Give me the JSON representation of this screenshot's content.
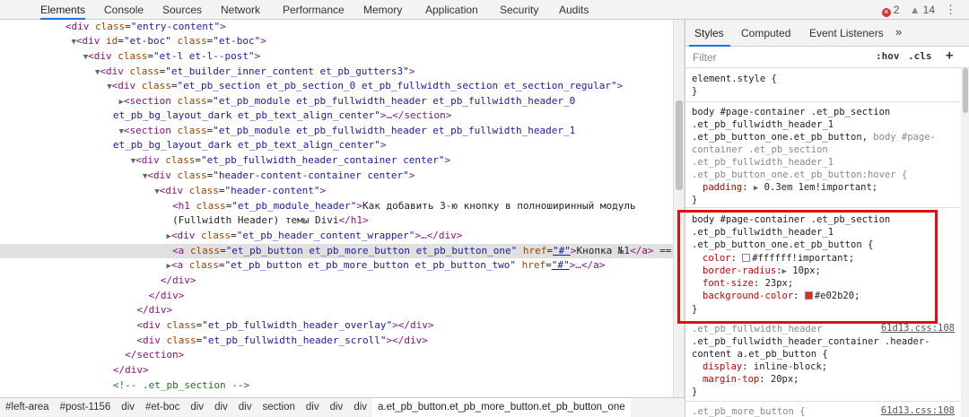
{
  "tabs": [
    {
      "label": "Elements",
      "active": true
    },
    {
      "label": "Console"
    },
    {
      "label": "Sources"
    },
    {
      "label": "Network"
    },
    {
      "label": "Performance"
    },
    {
      "label": "Memory"
    },
    {
      "label": "Application"
    },
    {
      "label": "Security"
    },
    {
      "label": "Audits"
    }
  ],
  "counts": {
    "errors": "2",
    "warnings": "14"
  },
  "icons": {
    "error": "error-icon",
    "warning": "warning-icon",
    "menu": "kebab-menu-icon",
    "more": "chevron-double-right-icon"
  },
  "dom": {
    "l0": {
      "tag": "<div ",
      "a1": "class",
      "v1": "\"entry-content\"",
      "end": ">"
    },
    "l1": {
      "tag": "<div ",
      "a1": "id",
      "v1": "\"et-boc\"",
      "a2": "class",
      "v2": "\"et-boc\"",
      "end": ">"
    },
    "l2": {
      "tag": "<div ",
      "a1": "class",
      "v1": "\"et-l et-l--post\"",
      "end": ">"
    },
    "l3": {
      "tag": "<div ",
      "a1": "class",
      "v1": "\"et_builder_inner_content et_pb_gutters3\"",
      "end": ">"
    },
    "l4": {
      "tag": "<div ",
      "a1": "class",
      "v1": "\"et_pb_section et_pb_section_0 et_pb_fullwidth_section et_section_regular\"",
      "end": ">"
    },
    "l5": {
      "tag": "<section ",
      "a1": "class",
      "v1": "\"et_pb_module et_pb_fullwidth_header et_pb_fullwidth_header_0",
      "v1b": "et_pb_bg_layout_dark et_pb_text_align_center\"",
      "end": ">…</section>"
    },
    "l6": {
      "tag": "<section ",
      "a1": "class",
      "v1": "\"et_pb_module et_pb_fullwidth_header et_pb_fullwidth_header_1",
      "v1b": "et_pb_bg_layout_dark et_pb_text_align_center\"",
      "end": ">"
    },
    "l7": {
      "tag": "<div ",
      "a1": "class",
      "v1": "\"et_pb_fullwidth_header_container center\"",
      "end": ">"
    },
    "l8": {
      "tag": "<div ",
      "a1": "class",
      "v1": "\"header-content-container center\"",
      "end": ">"
    },
    "l9": {
      "tag": "<div ",
      "a1": "class",
      "v1": "\"header-content\"",
      "end": ">"
    },
    "l10": {
      "tag": "<h1 ",
      "a1": "class",
      "v1": "\"et_pb_module_header\"",
      "end": ">",
      "text": "Как добавить 3-ю кнопку в полноширинный модуль",
      "text2": "(Fullwidth Header) темы Divi",
      "close": "</h1>"
    },
    "l11": {
      "tag": "<div ",
      "a1": "class",
      "v1": "\"et_pb_header_content_wrapper\"",
      "end": ">…</div>"
    },
    "l12": {
      "tag": "<a ",
      "a1": "class",
      "v1": "\"et_pb_button et_pb_more_button et_pb_button_one\"",
      "a2": "href",
      "v2": "\"#\"",
      "end": ">",
      "text": "Кнопка №1",
      "close": "</a>",
      "eq": " =="
    },
    "l13": {
      "tag": "<a ",
      "a1": "class",
      "v1": "\"et_pb_button et_pb_more_button et_pb_button_two\"",
      "a2": "href",
      "v2": "\"#\"",
      "end": ">…</a>"
    },
    "l14": {
      "close": "</div>"
    },
    "l15": {
      "close": "</div>"
    },
    "l16": {
      "close": "</div>"
    },
    "l17": {
      "tag": "<div ",
      "a1": "class",
      "v1": "\"et_pb_fullwidth_header_overlay\"",
      "end": "></div>"
    },
    "l18": {
      "tag": "<div ",
      "a1": "class",
      "v1": "\"et_pb_fullwidth_header_scroll\"",
      "end": "></div>"
    },
    "l19": {
      "close": "</section>"
    },
    "l20": {
      "close": "</div>"
    },
    "l21": {
      "comment": "<!-- .et_pb_section -->"
    }
  },
  "breadcrumbs": [
    "#left-area",
    "#post-1156",
    "div",
    "#et-boc",
    "div",
    "div",
    "div",
    "section",
    "div",
    "div",
    "div",
    "a.et_pb_button.et_pb_more_button.et_pb_button_one"
  ],
  "styles": {
    "subtabs": [
      "Styles",
      "Computed",
      "Event Listeners"
    ],
    "filter_placeholder": "Filter",
    "hov": ":hov",
    "cls": ".cls",
    "plus": "+",
    "element_style": "element.style {",
    "close_brace": "}",
    "r1": {
      "s1": "body #page-container .et_pb_section",
      "s2": ".et_pb_fullwidth_header_1",
      "s3a": ".et_pb_button_one.et_pb_button, ",
      "s3b": "body #page-",
      "s4": "container .et_pb_section",
      "s5": ".et_pb_fullwidth_header_1",
      "s6": ".et_pb_button_one.et_pb_button:hover {",
      "p1": "padding",
      "v1": "0.3em 1em!important;"
    },
    "r2": {
      "s1": "body #page-container .et_pb_section",
      "s2": ".et_pb_fullwidth_header_1",
      "s3": ".et_pb_button_one.et_pb_button {",
      "p1": "color",
      "v1": "#ffffff!important;",
      "c1": "#ffffff",
      "p2": "border-radius",
      "v2": "10px;",
      "p3": "font-size",
      "v3": "23px;",
      "p4": "background-color",
      "v4": "#e02b20;",
      "c4": "#e02b20"
    },
    "r3": {
      "s1": ".et_pb_fullwidth_header",
      "src": "61d13.css:108",
      "s2": ".et_pb_fullwidth_header_container .header-",
      "s3": "content a.et_pb_button {",
      "p1": "display",
      "v1": "inline-block;",
      "p2": "margin-top",
      "v2": "20px;"
    },
    "r4": {
      "s1": ".et_pb_more_button {",
      "src": "61d13.css:108"
    }
  }
}
